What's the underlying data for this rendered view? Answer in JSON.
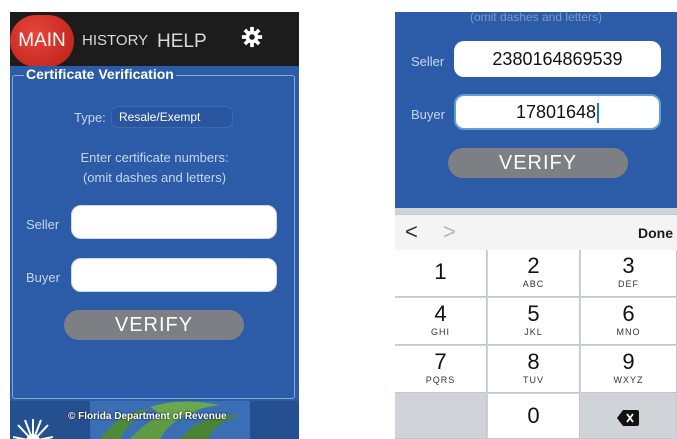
{
  "left": {
    "tabs": {
      "main": "MAIN",
      "history": "HISTORY",
      "help": "HELP"
    },
    "section_title": "Certificate Verification",
    "type_label": "Type:",
    "type_value": "Resale/Exempt",
    "instructions_line1": "Enter certificate numbers:",
    "instructions_line2": "(omit dashes and letters)",
    "seller_label": "Seller",
    "seller_value": "",
    "buyer_label": "Buyer",
    "buyer_value": "",
    "verify_label": "VERIFY",
    "footer_credit": "© Florida Department of Revenue"
  },
  "right": {
    "instructions_line2": "(omit dashes and letters)",
    "seller_label": "Seller",
    "seller_value": "2380164869539",
    "buyer_label": "Buyer",
    "buyer_value": "17801648",
    "verify_label": "VERIFY",
    "accessory": {
      "prev": "<",
      "next": ">",
      "done": "Done"
    },
    "keys": [
      {
        "num": "1",
        "letters": ""
      },
      {
        "num": "2",
        "letters": "ABC"
      },
      {
        "num": "3",
        "letters": "DEF"
      },
      {
        "num": "4",
        "letters": "GHI"
      },
      {
        "num": "5",
        "letters": "JKL"
      },
      {
        "num": "6",
        "letters": "MNO"
      },
      {
        "num": "7",
        "letters": "PQRS"
      },
      {
        "num": "8",
        "letters": "TUV"
      },
      {
        "num": "9",
        "letters": "WXYZ"
      },
      {
        "num": "0",
        "letters": ""
      }
    ]
  },
  "colors": {
    "app_blue": "#2c5ca8",
    "top_bar": "#1c1c1c",
    "main_tab_red": "#d63329",
    "button_gray": "#7d7f84"
  },
  "icons": [
    "gear-icon",
    "backspace-icon",
    "sunburst-logo-icon"
  ]
}
